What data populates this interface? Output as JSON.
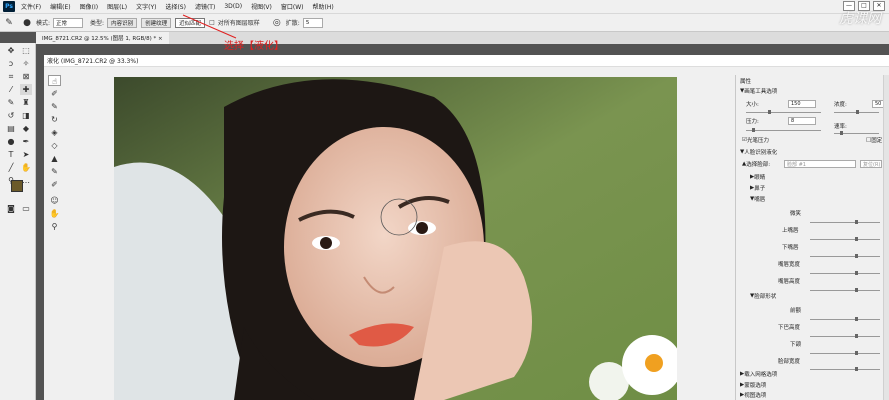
{
  "menu": {
    "items": [
      "文件(F)",
      "编辑(E)",
      "图像(I)",
      "图层(L)",
      "文字(Y)",
      "选择(S)",
      "滤镜(T)",
      "3D(D)",
      "视图(V)",
      "窗口(W)",
      "帮助(H)"
    ],
    "window_controls": [
      "—",
      "□",
      "✕"
    ]
  },
  "watermark": "虎课网",
  "options": {
    "mode_label": "模式:",
    "mode_value": "正常",
    "type_label": "类型:",
    "btn_content_aware": "内容识别",
    "btn_create_texture": "创建纹理",
    "btn_proximity": "近似匹配",
    "sample_all_layers": "对所有图层取样",
    "angle_label": "扩散:",
    "angle_value": "5"
  },
  "callout": "选择【液化】",
  "document_tab": "IMG_8721.CR2 @ 12.5% (图层 1, RGB/8) * ×",
  "liquify": {
    "title": "液化 (IMG_8721.CR2 @ 33.3%)"
  },
  "properties": {
    "header": "属性",
    "brush_section": "画笔工具选项",
    "size_label": "大小:",
    "size_value": "150",
    "density_label": "浓度:",
    "density_value": "50",
    "pressure_label": "压力:",
    "pressure_value": "8",
    "rate_label": "速率:",
    "stylus_label": "光笔压力",
    "stylus_checked": true,
    "pin_label": "固定",
    "face_section": "人脸识别液化",
    "select_face_label": "选择脸部:",
    "select_face_value": "脸部 #1",
    "reset_label": "复位(R)",
    "subsections": [
      "眼睛",
      "鼻子",
      "嘴唇"
    ],
    "lip_sliders": [
      "微笑",
      "上嘴唇",
      "下嘴唇",
      "嘴唇宽度",
      "嘴唇高度"
    ],
    "face_shape_label": "脸部形状",
    "face_shape_sliders": [
      "前额",
      "下巴高度",
      "下颌",
      "脸部宽度"
    ],
    "bottom_sections": [
      "载入网格选项",
      "蒙版选项",
      "视图选项"
    ]
  },
  "colors": {
    "accent_red": "#e02020",
    "panel_bg": "#f0f0f0",
    "foreground_swatch": "#6b5a2a"
  }
}
